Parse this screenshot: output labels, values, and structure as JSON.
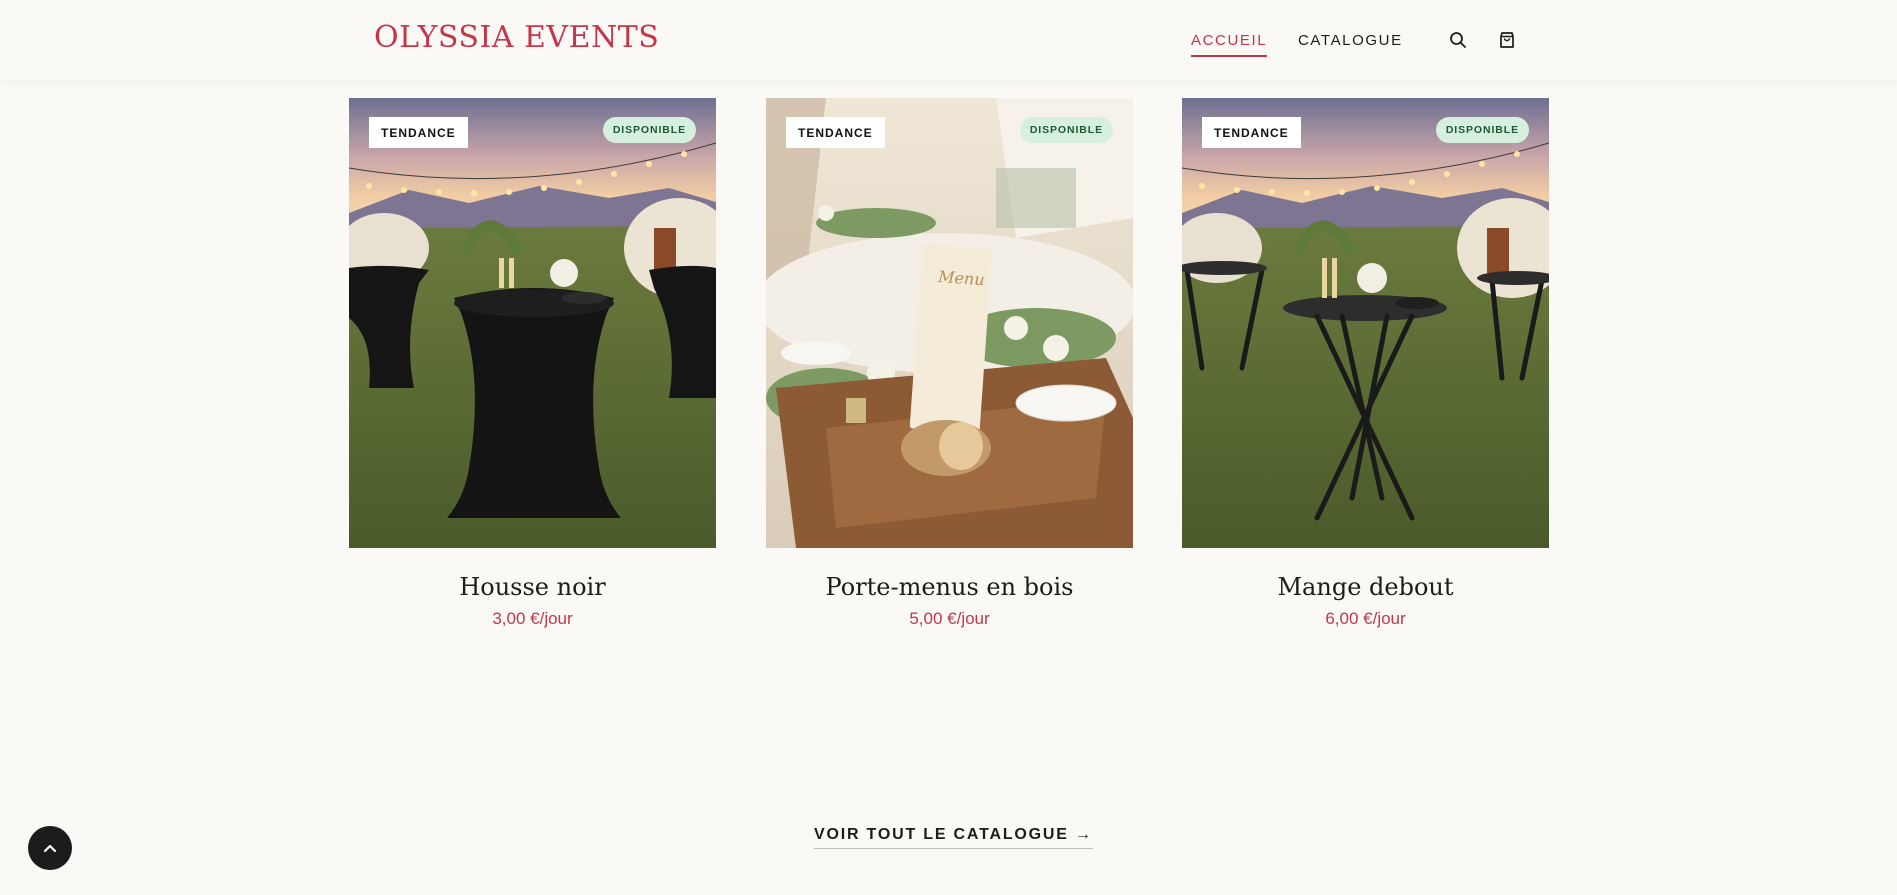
{
  "header": {
    "logo": "OLYSSIA EVENTS",
    "nav": [
      {
        "label": "ACCUEIL",
        "active": true
      },
      {
        "label": "CATALOGUE",
        "active": false
      }
    ],
    "icons": [
      "search-icon",
      "shopping-bag-icon"
    ]
  },
  "products": [
    {
      "title": "Housse noir",
      "price": "3,00 €/jour",
      "badge": "TENDANCE",
      "status": "DISPONIBLE",
      "image": "black stretch cocktail table in yurt garden at sunset"
    },
    {
      "title": "Porte-menus en bois",
      "price": "5,00 €/jour",
      "badge": "TENDANCE",
      "status": "DISPONIBLE",
      "image": "wooden log menu holder on wedding table"
    },
    {
      "title": "Mange debout",
      "price": "6,00 €/jour",
      "badge": "TENDANCE",
      "status": "DISPONIBLE",
      "image": "folding standing table in yurt garden at sunset"
    }
  ],
  "cta": {
    "label": "VOIR TOUT LE CATALOGUE →"
  },
  "colors": {
    "accent": "#c4364a",
    "background": "#fbf9f5",
    "available_badge": "#d7efdf"
  },
  "back_to_top_icon": "chevron-up-icon"
}
